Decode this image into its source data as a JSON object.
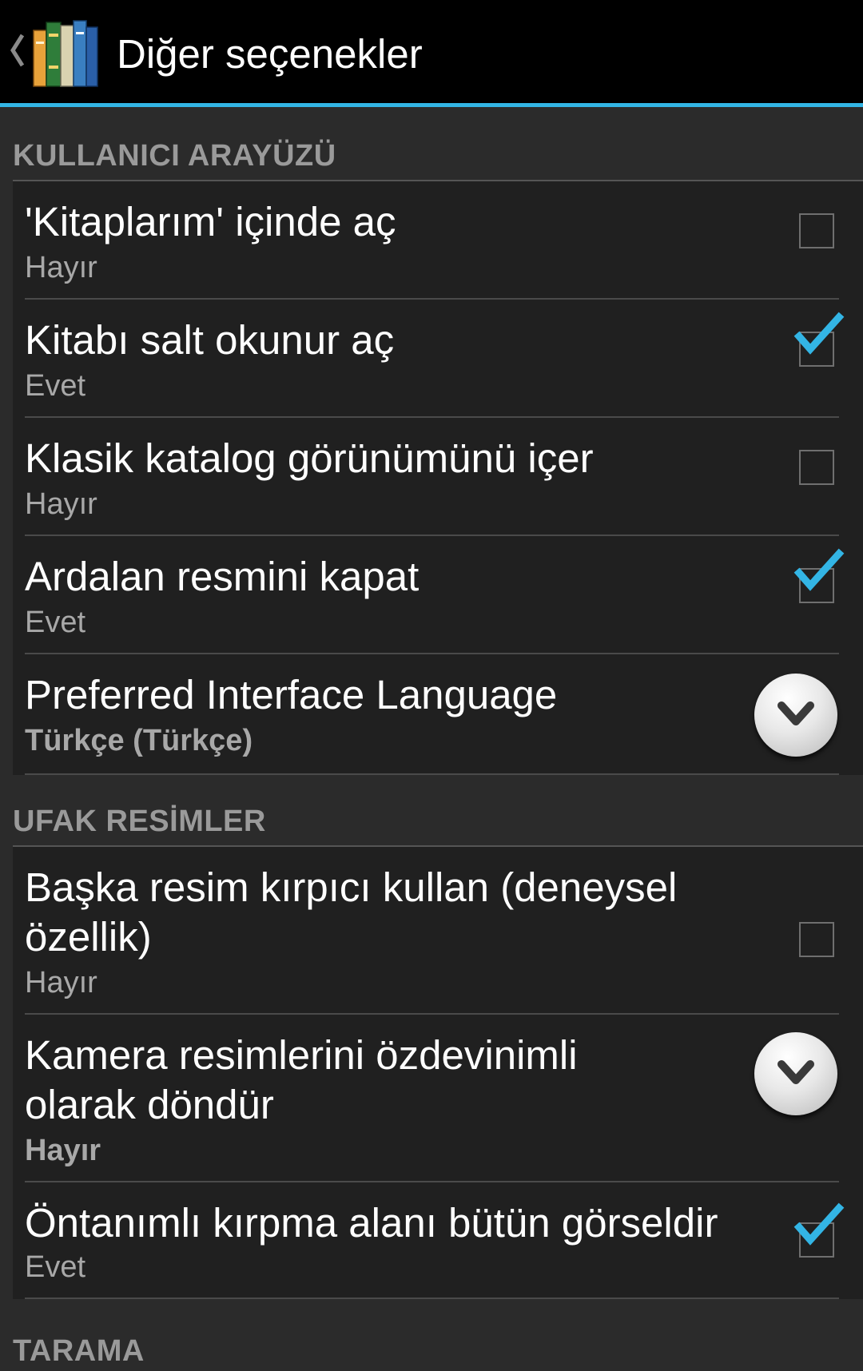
{
  "actionbar": {
    "title": "Diğer seçenekler",
    "accent_color": "#33b5e5"
  },
  "icons": {
    "back": "back-chevron-icon",
    "app": "books-app-icon",
    "checkbox_checked": "checkmark-icon",
    "dropdown": "chevron-down-icon"
  },
  "sections": {
    "ui": {
      "header": "KULLANICI ARAYÜZÜ",
      "items": [
        {
          "title": "'Kitaplarım' içinde aç",
          "summary": "Hayır",
          "control": "checkbox",
          "checked": false
        },
        {
          "title": "Kitabı salt okunur aç",
          "summary": "Evet",
          "control": "checkbox",
          "checked": true
        },
        {
          "title": "Klasik katalog görünümünü içer",
          "summary": "Hayır",
          "control": "checkbox",
          "checked": false
        },
        {
          "title": "Ardalan resmini kapat",
          "summary": "Evet",
          "control": "checkbox",
          "checked": true
        },
        {
          "title": "Preferred Interface Language",
          "summary": "Türkçe (Türkçe)",
          "control": "dropdown"
        }
      ]
    },
    "thumbnails": {
      "header": "UFAK RESİMLER",
      "items": [
        {
          "title": "Başka resim kırpıcı kullan (deneysel özellik)",
          "summary": "Hayır",
          "control": "checkbox",
          "checked": false
        },
        {
          "title": "Kamera resimlerini özdevinimli olarak döndür",
          "summary": "Hayır",
          "control": "dropdown"
        },
        {
          "title": "Öntanımlı kırpma alanı bütün görseldir",
          "summary": "Evet",
          "control": "checkbox",
          "checked": true
        }
      ]
    },
    "scanning": {
      "header": "TARAMA"
    }
  }
}
